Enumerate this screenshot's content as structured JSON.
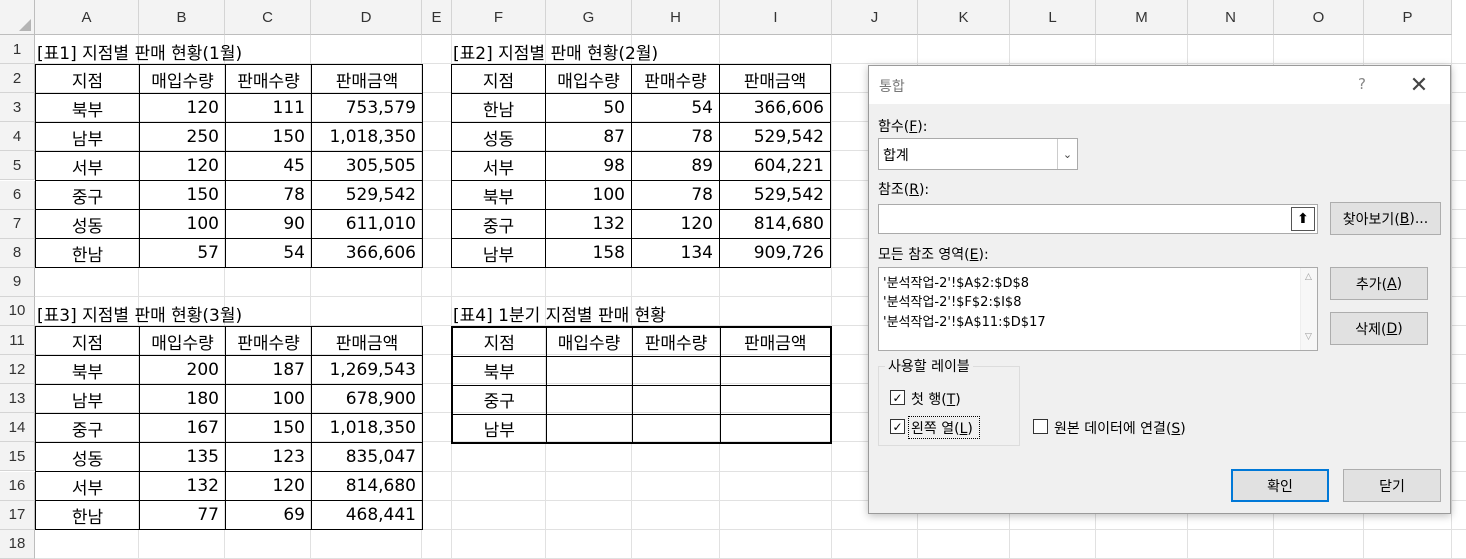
{
  "columns": [
    "A",
    "B",
    "C",
    "D",
    "E",
    "F",
    "G",
    "H",
    "I",
    "J",
    "K",
    "L",
    "M",
    "N",
    "O",
    "P"
  ],
  "rows": [
    "1",
    "2",
    "3",
    "4",
    "5",
    "6",
    "7",
    "8",
    "9",
    "10",
    "11",
    "12",
    "13",
    "14",
    "15",
    "16",
    "17",
    "18"
  ],
  "tables": {
    "t1": {
      "title": "[표1] 지점별 판매 현황(1월)",
      "headers": [
        "지점",
        "매입수량",
        "판매수량",
        "판매금액"
      ],
      "rows": [
        [
          "북부",
          "120",
          "111",
          "753,579"
        ],
        [
          "남부",
          "250",
          "150",
          "1,018,350"
        ],
        [
          "서부",
          "120",
          "45",
          "305,505"
        ],
        [
          "중구",
          "150",
          "78",
          "529,542"
        ],
        [
          "성동",
          "100",
          "90",
          "611,010"
        ],
        [
          "한남",
          "57",
          "54",
          "366,606"
        ]
      ]
    },
    "t2": {
      "title": "[표2] 지점별 판매 현황(2월)",
      "headers": [
        "지점",
        "매입수량",
        "판매수량",
        "판매금액"
      ],
      "rows": [
        [
          "한남",
          "50",
          "54",
          "366,606"
        ],
        [
          "성동",
          "87",
          "78",
          "529,542"
        ],
        [
          "서부",
          "98",
          "89",
          "604,221"
        ],
        [
          "북부",
          "100",
          "78",
          "529,542"
        ],
        [
          "중구",
          "132",
          "120",
          "814,680"
        ],
        [
          "남부",
          "158",
          "134",
          "909,726"
        ]
      ]
    },
    "t3": {
      "title": "[표3] 지점별 판매 현황(3월)",
      "headers": [
        "지점",
        "매입수량",
        "판매수량",
        "판매금액"
      ],
      "rows": [
        [
          "북부",
          "200",
          "187",
          "1,269,543"
        ],
        [
          "남부",
          "180",
          "100",
          "678,900"
        ],
        [
          "중구",
          "167",
          "150",
          "1,018,350"
        ],
        [
          "성동",
          "135",
          "123",
          "835,047"
        ],
        [
          "서부",
          "132",
          "120",
          "814,680"
        ],
        [
          "한남",
          "77",
          "69",
          "468,441"
        ]
      ]
    },
    "t4": {
      "title": "[표4] 1분기 지점별 판매 현황",
      "headers": [
        "지점",
        "매입수량",
        "판매수량",
        "판매금액"
      ],
      "rows": [
        [
          "북부",
          "",
          "",
          ""
        ],
        [
          "중구",
          "",
          "",
          ""
        ],
        [
          "남부",
          "",
          "",
          ""
        ]
      ]
    }
  },
  "dialog": {
    "title": "통합",
    "help": "?",
    "close": "✕",
    "function_label": "함수(",
    "function_key": "F",
    "function_label_end": "):",
    "function_value": "합계",
    "reference_label": "참조(",
    "reference_key": "R",
    "reference_label_end": "):",
    "reference_value": "",
    "browse_label": "찾아보기(",
    "browse_key": "B",
    "browse_end": ")...",
    "all_refs_label": "모든 참조 영역(",
    "all_refs_key": "E",
    "all_refs_end": "):",
    "all_refs": [
      "'분석작업-2'!$A$2:$D$8",
      "'분석작업-2'!$F$2:$I$8",
      "'분석작업-2'!$A$11:$D$17"
    ],
    "add_label": "추가(",
    "add_key": "A",
    "add_end": ")",
    "delete_label": "삭제(",
    "delete_key": "D",
    "delete_end": ")",
    "use_labels_title": "사용할 레이블",
    "top_row_label": "첫 행(",
    "top_row_key": "T",
    "top_row_end": ")",
    "top_row_checked": true,
    "left_col_label": "왼쪽 열(",
    "left_col_key": "L",
    "left_col_end": ")",
    "left_col_checked": true,
    "link_label": "원본 데이터에 연결(",
    "link_key": "S",
    "link_end": ")",
    "link_checked": false,
    "ok_label": "확인",
    "close_label": "닫기",
    "check_glyph": "✓"
  }
}
